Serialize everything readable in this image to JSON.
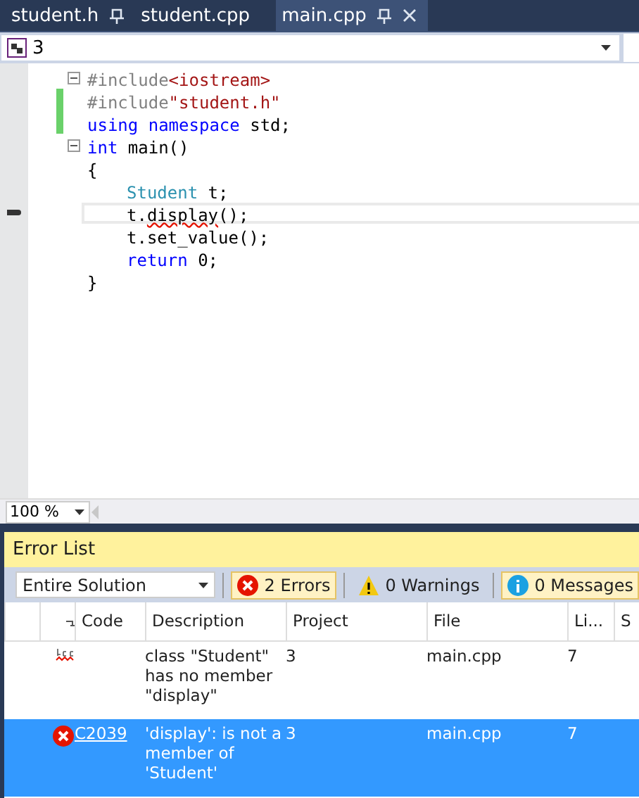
{
  "tabs": [
    {
      "label": "student.h",
      "selected": false,
      "pinned": true,
      "closable": false
    },
    {
      "label": "student.cpp",
      "selected": false,
      "pinned": false,
      "closable": false
    },
    {
      "label": "main.cpp",
      "selected": true,
      "pinned": true,
      "closable": true
    }
  ],
  "nav_bar": {
    "project": "3"
  },
  "code_lines": [
    {
      "fold_start": true,
      "changed": false,
      "current": false,
      "indented": false,
      "tokens": [
        {
          "kind": "preproc",
          "text": "#include"
        },
        {
          "kind": "string",
          "text": "<iostream>"
        }
      ]
    },
    {
      "fold_start": false,
      "changed": true,
      "current": false,
      "indented": false,
      "tokens": [
        {
          "kind": "preproc",
          "text": "#include"
        },
        {
          "kind": "string",
          "text": "\"student.h\""
        }
      ]
    },
    {
      "fold_start": false,
      "changed": true,
      "current": false,
      "indented": false,
      "tokens": [
        {
          "kind": "keyword",
          "text": "using namespace"
        },
        {
          "kind": "plain",
          "text": " std;"
        }
      ]
    },
    {
      "fold_start": true,
      "changed": false,
      "current": false,
      "indented": false,
      "tokens": [
        {
          "kind": "keyword",
          "text": "int"
        },
        {
          "kind": "plain",
          "text": " main()"
        }
      ]
    },
    {
      "fold_start": false,
      "changed": false,
      "current": false,
      "indented": false,
      "tokens": [
        {
          "kind": "plain",
          "text": "{"
        }
      ]
    },
    {
      "fold_start": false,
      "changed": false,
      "current": false,
      "indented": true,
      "tokens": [
        {
          "kind": "type",
          "text": "Student"
        },
        {
          "kind": "plain",
          "text": " t;"
        }
      ]
    },
    {
      "fold_start": false,
      "changed": false,
      "current": true,
      "indented": true,
      "tokens": [
        {
          "kind": "plain",
          "text": "t."
        },
        {
          "kind": "error",
          "text": "display"
        },
        {
          "kind": "plain",
          "text": "();"
        }
      ]
    },
    {
      "fold_start": false,
      "changed": false,
      "current": false,
      "indented": true,
      "tokens": [
        {
          "kind": "plain",
          "text": "t.set_value();"
        }
      ]
    },
    {
      "fold_start": false,
      "changed": false,
      "current": false,
      "indented": true,
      "tokens": [
        {
          "kind": "keyword",
          "text": "return"
        },
        {
          "kind": "plain",
          "text": " 0;"
        }
      ]
    },
    {
      "fold_start": false,
      "changed": false,
      "current": false,
      "indented": false,
      "tokens": [
        {
          "kind": "plain",
          "text": "}"
        }
      ]
    }
  ],
  "zoom": "100 %",
  "error_list": {
    "title": "Error List",
    "scope": "Entire Solution",
    "filters": [
      {
        "kind": "error",
        "label": "2 Errors",
        "selected": true
      },
      {
        "kind": "warning",
        "label": "0 Warnings",
        "selected": false
      },
      {
        "kind": "message",
        "label": "0 Messages",
        "selected": true
      }
    ],
    "columns": [
      "Code",
      "Description",
      "Project",
      "File",
      "Li...",
      "S"
    ],
    "rows": [
      {
        "kind": "intellisense",
        "selected": false,
        "description": "class \"Student\" has no member \"display\"",
        "project": "3",
        "file": "main.cpp",
        "line": "7"
      },
      {
        "kind": "error",
        "selected": true,
        "code": "C2039",
        "description": "'display': is not a member of 'Student'",
        "project": "3",
        "file": "main.cpp",
        "line": "7"
      }
    ]
  }
}
